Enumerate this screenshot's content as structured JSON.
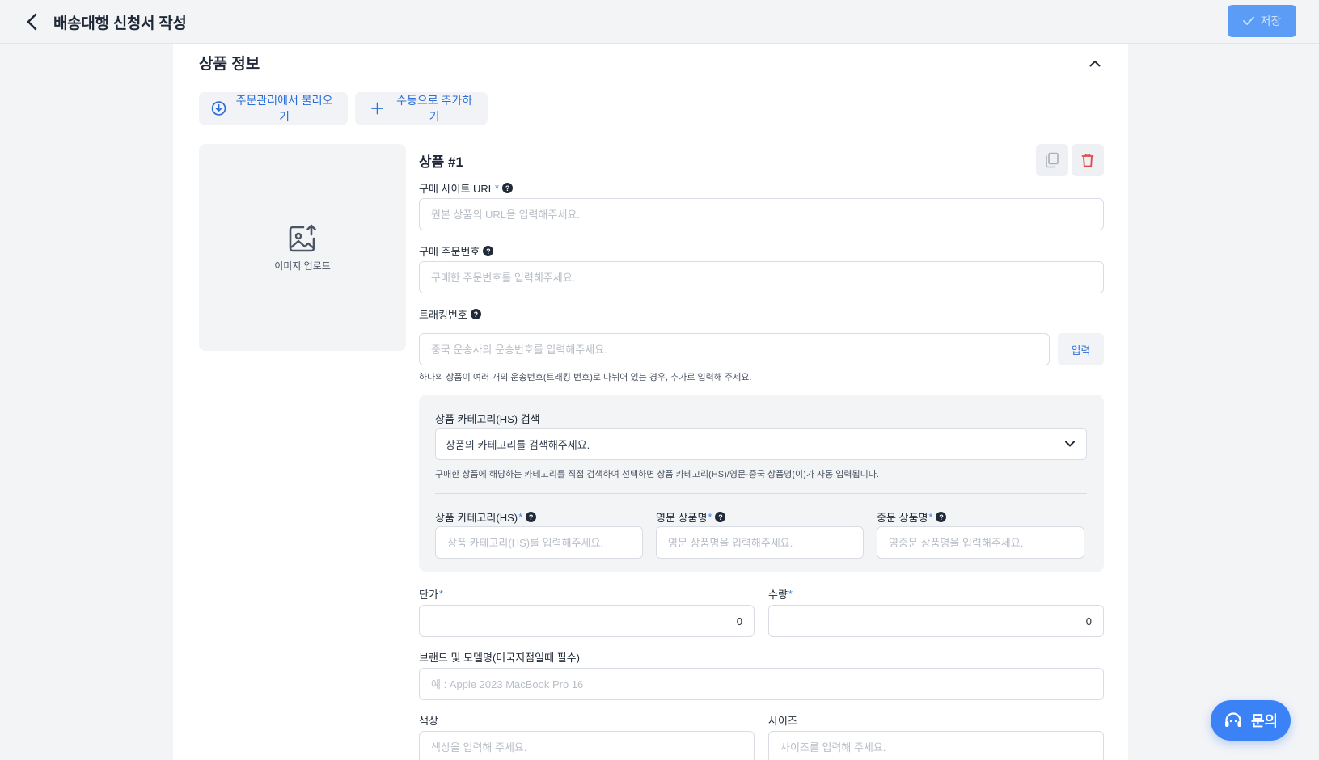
{
  "header": {
    "title": "배송대행 신청서 작성",
    "save_label": "저장"
  },
  "section": {
    "title": "상품 정보",
    "import_button": "주문관리에서 불러오기",
    "manual_add_button": "수동으로 추가하기"
  },
  "product": {
    "title": "상품 #1",
    "image_upload_label": "이미지 업로드",
    "url_label": "구매 사이트 URL",
    "url_placeholder": "원본 상품의 URL을 입력해주세요.",
    "order_no_label": "구매 주문번호",
    "order_no_placeholder": "구매한 주문번호를 입력해주세요.",
    "tracking_label": "트래킹번호",
    "tracking_placeholder": "중국 운송사의 운송번호를 입력해주세요.",
    "tracking_enter_button": "입력",
    "tracking_hint": "하나의 상품이 여러 개의 운송번호(트래킹 번호)로 나뉘어 있는 경우, 추가로 입력해 주세요.",
    "hs_search_label": "상품 카테고리(HS) 검색",
    "hs_search_placeholder": "상품의 카테고리를 검색해주세요.",
    "hs_search_hint": "구매한 상품에 해당하는 카테고리를 직접 검색하여 선택하면 상품 카테고리(HS)/영문·중국 상품명(이)가 자동 입력됩니다.",
    "hs_category_label": "상품 카테고리(HS)",
    "hs_category_placeholder": "상품 카테고리(HS)를 입력해주세요.",
    "en_name_label": "영문 상품명",
    "en_name_placeholder": "영문 상품명을 입력해주세요.",
    "cn_name_label": "중문 상품명",
    "cn_name_placeholder": "영중문 상품명을 입력해주세요.",
    "unit_price_label": "단가",
    "unit_price_value": "0",
    "quantity_label": "수량",
    "quantity_value": "0",
    "brand_label": "브랜드 및 모델명(미국지점일때 필수)",
    "brand_placeholder": "예 : Apple 2023 MacBook Pro 16",
    "color_label": "색상",
    "color_placeholder": "색상을 입력해 주세요.",
    "size_label": "사이즈",
    "size_placeholder": "사이즈를 입력해 주세요.",
    "required_mark": "*",
    "help_mark": "?"
  },
  "fab": {
    "label": "문의"
  },
  "colors": {
    "primary": "#3b82f6",
    "save_button": "#5b9cf6",
    "link_text": "#2b6fd6",
    "delete_icon": "#e04848",
    "page_bg": "#f3f4f6"
  },
  "icons": {
    "back": "chevron-left-icon",
    "save": "check-icon",
    "collapse": "chevron-up-icon",
    "import": "download-circle-icon",
    "add": "plus-icon",
    "upload": "image-upload-icon",
    "copy": "copy-icon",
    "delete": "trash-icon",
    "dropdown": "chevron-down-icon",
    "inquiry": "headset-icon"
  }
}
